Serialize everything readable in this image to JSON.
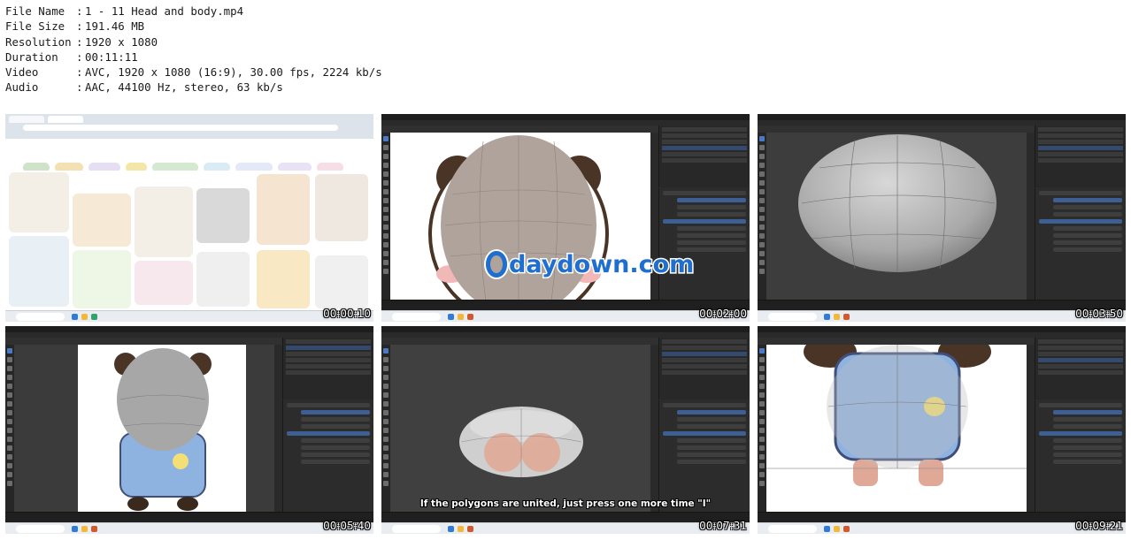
{
  "info": [
    {
      "key": "File Name",
      "value": "1 - 11 Head and body.mp4"
    },
    {
      "key": "File Size",
      "value": "191.46 MB"
    },
    {
      "key": "Resolution",
      "value": "1920 x 1080"
    },
    {
      "key": "Duration",
      "value": "00:11:11"
    },
    {
      "key": "Video",
      "value": "AVC, 1920 x 1080 (16:9), 30.00 fps, 2224 kb/s"
    },
    {
      "key": "Audio",
      "value": "AAC, 44100 Hz, stereo, 63 kb/s"
    }
  ],
  "info_separator": ":",
  "thumbnails": [
    {
      "timestamp": "00:00:10",
      "scene": "Pinterest search: chibi animals"
    },
    {
      "timestamp": "00:02:00",
      "scene": "Blender head over bear reference"
    },
    {
      "timestamp": "00:03:50",
      "scene": "Blender subdivided head mesh"
    },
    {
      "timestamp": "00:05:40",
      "scene": "Blender head on chibi reference"
    },
    {
      "timestamp": "00:07:31",
      "scene": "Blender flattened mesh"
    },
    {
      "timestamp": "00:09:21",
      "scene": "Blender body over reference"
    }
  ],
  "watermark": "daydown.com",
  "caption": "If the polygons are united, just press one more time \"I\"",
  "colors": {
    "blender_bg": "#2b2b2b",
    "mesh_gray": "#b9b9b9",
    "bear_brown": "#4a3426",
    "watermark_blue": "#1e6fd0",
    "pinterest_red": "#e60023"
  }
}
